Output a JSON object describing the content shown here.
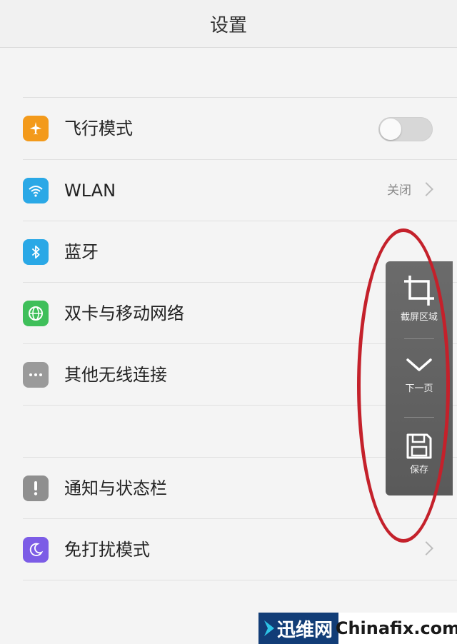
{
  "header": {
    "title": "设置"
  },
  "settings": {
    "airplane": {
      "label": "飞行模式",
      "icon": "airplane-icon",
      "color": "#f39a1b"
    },
    "wlan": {
      "label": "WLAN",
      "value": "关闭",
      "icon": "wifi-icon",
      "color": "#2aa8e6"
    },
    "bluetooth": {
      "label": "蓝牙",
      "icon": "bluetooth-icon",
      "color": "#2aa8e6"
    },
    "dualsim": {
      "label": "双卡与移动网络",
      "icon": "globe-icon",
      "color": "#3fbf5a"
    },
    "other_wireless": {
      "label": "其他无线连接",
      "icon": "more-icon",
      "color": "#9a9a9a"
    },
    "notifications": {
      "label": "通知与状态栏",
      "icon": "exclamation-icon",
      "color": "#8f8f8f"
    },
    "dnd": {
      "label": "免打扰模式",
      "icon": "moon-icon",
      "color": "#7c5ce6"
    }
  },
  "toolbar": {
    "crop_label": "截屏区域",
    "next_label": "下一页",
    "save_label": "保存"
  },
  "watermark": {
    "left": "迅维网",
    "right": "Chinafix.com"
  }
}
